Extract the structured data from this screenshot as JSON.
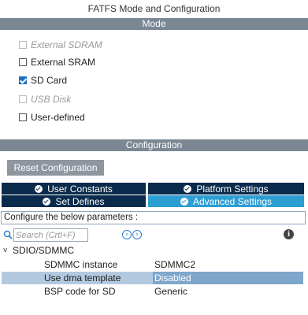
{
  "window": {
    "title": "FATFS Mode and Configuration"
  },
  "mode": {
    "header": "Mode",
    "items": [
      {
        "label": "External SDRAM",
        "checked": false,
        "disabled": true
      },
      {
        "label": "External SRAM",
        "checked": false,
        "disabled": false
      },
      {
        "label": "SD Card",
        "checked": true,
        "disabled": false
      },
      {
        "label": "USB Disk",
        "checked": false,
        "disabled": true
      },
      {
        "label": "User-defined",
        "checked": false,
        "disabled": false
      }
    ]
  },
  "configuration": {
    "header": "Configuration",
    "reset_label": "Reset Configuration",
    "tabs": [
      {
        "label": "User Constants",
        "active": false
      },
      {
        "label": "Platform Settings",
        "active": false
      },
      {
        "label": "Set Defines",
        "active": false
      },
      {
        "label": "Advanced Settings",
        "active": true
      }
    ],
    "instruction": "Configure the below parameters :",
    "search": {
      "placeholder": "Search (Crtl+F)"
    },
    "group": {
      "label": "SDIO/SDMMC",
      "params": [
        {
          "name": "SDMMC instance",
          "value": "SDMMC2",
          "selected": false
        },
        {
          "name": "Use dma template",
          "value": "Disabled",
          "selected": true
        },
        {
          "name": "BSP code for SD",
          "value": "Generic",
          "selected": false
        }
      ]
    }
  },
  "colors": {
    "section_bar": "#7b8793",
    "tab_dark": "#0b2b4c",
    "tab_active": "#2d9ed2",
    "checkbox_checked": "#1e6ec8",
    "row_selected": "#b3c9e0"
  }
}
